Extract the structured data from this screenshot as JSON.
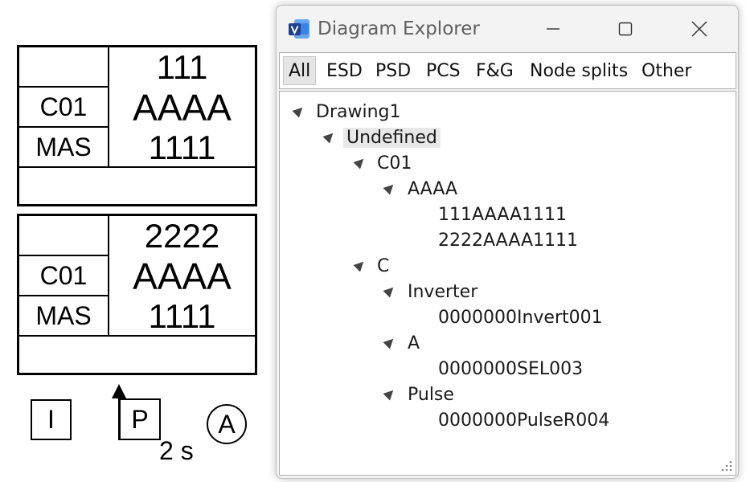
{
  "drawing": {
    "block1": {
      "left": [
        "",
        "C01",
        "MAS"
      ],
      "right": [
        "111",
        "AAAA",
        "1111"
      ]
    },
    "block2": {
      "left": [
        "",
        "C01",
        "MAS"
      ],
      "right": [
        "2222",
        "AAAA",
        "1111"
      ]
    },
    "symbols": {
      "i": "I",
      "p": "P",
      "a": "A",
      "timer": "2 s"
    }
  },
  "window": {
    "title": "Diagram Explorer",
    "tabs": [
      "All",
      "ESD",
      "PSD",
      "PCS",
      "F&G",
      "Node splits",
      "Other"
    ],
    "active_tab": "All",
    "tree": [
      {
        "label": "Drawing1",
        "level": 0,
        "expanded": true
      },
      {
        "label": "Undefined",
        "level": 1,
        "expanded": true,
        "selected": true
      },
      {
        "label": "C01",
        "level": 2,
        "expanded": true
      },
      {
        "label": "AAAA",
        "level": 3,
        "expanded": true
      },
      {
        "label": "111AAAA1111",
        "level": 4
      },
      {
        "label": "2222AAAA1111",
        "level": 4
      },
      {
        "label": "C",
        "level": 2,
        "expanded": true
      },
      {
        "label": "Inverter",
        "level": 3,
        "expanded": true
      },
      {
        "label": "0000000Invert001",
        "level": 4
      },
      {
        "label": "A",
        "level": 3,
        "expanded": true
      },
      {
        "label": "0000000SEL003",
        "level": 4
      },
      {
        "label": "Pulse",
        "level": 3,
        "expanded": true
      },
      {
        "label": "0000000PulseR004",
        "level": 4
      }
    ]
  },
  "colors": {
    "icon_blue": "#2b6fd6",
    "icon_dark": "#1d3f8f",
    "tab_active_bg": "#e5e5e5"
  }
}
